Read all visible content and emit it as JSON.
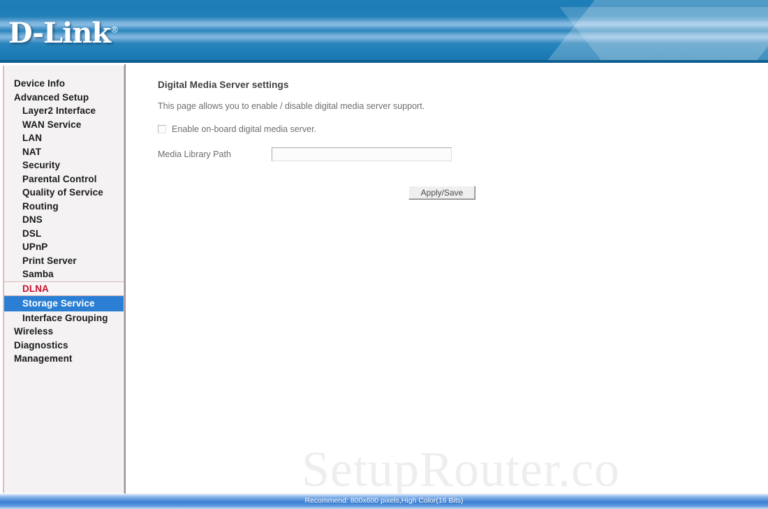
{
  "header": {
    "logo_text": "D-Link",
    "logo_tm": "®"
  },
  "sidebar": {
    "items": [
      {
        "label": "Device Info",
        "level": 1,
        "state": "normal"
      },
      {
        "label": "Advanced Setup",
        "level": 1,
        "state": "normal"
      },
      {
        "label": "Layer2 Interface",
        "level": 2,
        "state": "normal"
      },
      {
        "label": "WAN Service",
        "level": 2,
        "state": "normal"
      },
      {
        "label": "LAN",
        "level": 2,
        "state": "normal"
      },
      {
        "label": "NAT",
        "level": 2,
        "state": "normal"
      },
      {
        "label": "Security",
        "level": 2,
        "state": "normal"
      },
      {
        "label": "Parental Control",
        "level": 2,
        "state": "normal"
      },
      {
        "label": "Quality of Service",
        "level": 2,
        "state": "normal"
      },
      {
        "label": "Routing",
        "level": 2,
        "state": "normal"
      },
      {
        "label": "DNS",
        "level": 2,
        "state": "normal"
      },
      {
        "label": "DSL",
        "level": 2,
        "state": "normal"
      },
      {
        "label": "UPnP",
        "level": 2,
        "state": "normal"
      },
      {
        "label": "Print Server",
        "level": 2,
        "state": "normal"
      },
      {
        "label": "Samba",
        "level": 2,
        "state": "normal"
      },
      {
        "label": "DLNA",
        "level": 2,
        "state": "active"
      },
      {
        "label": "Storage Service",
        "level": 2,
        "state": "selected"
      },
      {
        "label": "Interface Grouping",
        "level": 2,
        "state": "normal"
      },
      {
        "label": "Wireless",
        "level": 1,
        "state": "normal"
      },
      {
        "label": "Diagnostics",
        "level": 1,
        "state": "normal"
      },
      {
        "label": "Management",
        "level": 1,
        "state": "normal"
      }
    ]
  },
  "main": {
    "title": "Digital Media Server settings",
    "description": "This page allows you to enable / disable digital media server support.",
    "enable_checkbox_label": "Enable on-board digital media server.",
    "enable_checkbox_checked": false,
    "media_library_path_label": "Media Library Path",
    "media_library_path_value": "",
    "media_library_path_placeholder": "",
    "apply_save_label": "Apply/Save"
  },
  "watermark": {
    "text": "SetupRouter.co"
  },
  "footer": {
    "text": "Recommend: 800x600 pixels,High Color(16 Bits)"
  },
  "colors": {
    "banner_blue": "#1f7fb8",
    "banner_light_band": "#86bbe1",
    "active_nav_red": "#c8102e",
    "selected_nav_bg": "#2a7fd4",
    "sidebar_bg": "#f4f2f2",
    "footer_blue": "#3b7fd4",
    "body_text": "#6d6d6d"
  }
}
